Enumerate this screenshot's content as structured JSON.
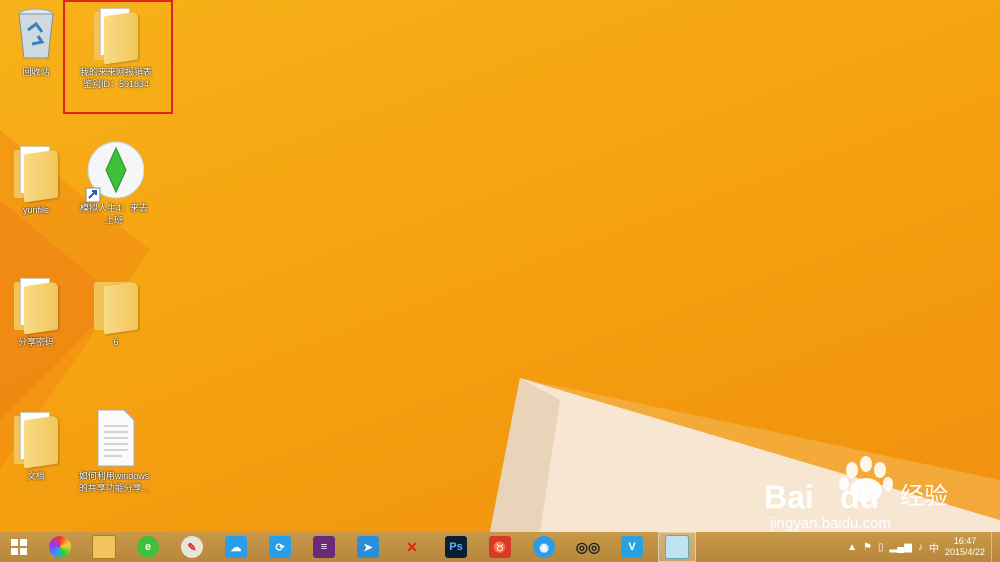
{
  "desktop": {
    "icons": [
      {
        "label": "回收站",
        "icon": "recycle-bin-icon"
      },
      {
        "label": "我的来来网报销表 鉴别ID：591834",
        "icon": "folder-icon"
      },
      {
        "label": "yunfile",
        "icon": "folder-icon"
      },
      {
        "label": "模拟人生4：来去上班",
        "icon": "sims-shortcut-icon"
      },
      {
        "label": "分享密码",
        "icon": "folder-icon"
      },
      {
        "label": "6",
        "icon": "folder-icon"
      },
      {
        "label": "文档",
        "icon": "folder-icon"
      },
      {
        "label": "如何利用windows的共享功能分享...",
        "icon": "text-document-icon"
      }
    ]
  },
  "watermark": {
    "brand": "Bai",
    "brand2": "du",
    "cn": "经验",
    "url": "jingyan.baidu.com"
  },
  "taskbar": {
    "apps": [
      {
        "name": "start-button",
        "icon": "windows-logo-icon"
      },
      {
        "name": "taskbar-app-1",
        "icon": "colorful-app-icon"
      },
      {
        "name": "taskbar-file-explorer",
        "icon": "file-explorer-icon"
      },
      {
        "name": "taskbar-app-3",
        "icon": "green-e-icon"
      },
      {
        "name": "taskbar-app-4",
        "icon": "paint-icon"
      },
      {
        "name": "taskbar-app-5",
        "icon": "cloud-icon"
      },
      {
        "name": "taskbar-app-6",
        "icon": "sync-icon"
      },
      {
        "name": "taskbar-app-7",
        "icon": "books-icon"
      },
      {
        "name": "taskbar-app-8",
        "icon": "bird-icon"
      },
      {
        "name": "taskbar-app-9",
        "icon": "red-x-icon"
      },
      {
        "name": "taskbar-photoshop",
        "icon": "photoshop-icon",
        "text": "Ps"
      },
      {
        "name": "taskbar-app-11",
        "icon": "cow-icon"
      },
      {
        "name": "taskbar-app-12",
        "icon": "chat-bubble-icon"
      },
      {
        "name": "taskbar-app-13",
        "icon": "binoculars-icon"
      },
      {
        "name": "taskbar-app-14",
        "icon": "v-icon",
        "text": "V"
      },
      {
        "name": "taskbar-app-15",
        "icon": "window-icon"
      }
    ],
    "tray": {
      "ime": "中",
      "time": "16:47",
      "date": "2015/4/22"
    }
  },
  "colors": {
    "highlight": "#e0231b",
    "taskbar": "#bf8f42",
    "wallpaper": "#f6a612"
  }
}
